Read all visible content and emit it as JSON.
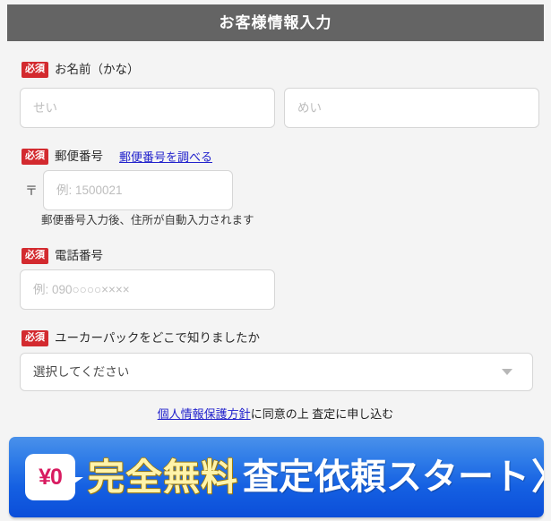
{
  "header": {
    "title": "お客様情報入力",
    "bg_color": "#646464",
    "text_color": "#ffffff"
  },
  "required_badge_label": "必須",
  "colors": {
    "required_badge": "#d32a2f",
    "link": "#2222cc",
    "page_bg": "#f4f4f4",
    "input_border": "#d6d6d6",
    "cta_blue_top": "#4a91ea",
    "cta_blue_bottom": "#0b4ed9",
    "cta_free_text": "#fff3aa",
    "yen_badge_text": "#d81b60"
  },
  "fields": {
    "name": {
      "label": "お名前（かな）",
      "required": "必須",
      "last_name_placeholder": "せい",
      "last_name_value": "",
      "first_name_placeholder": "めい",
      "first_name_value": ""
    },
    "postal": {
      "label": "郵便番号",
      "required": "必須",
      "lookup_link": "郵便番号を調べる",
      "prefix_symbol": "〒",
      "placeholder": "例: 1500021",
      "value": "",
      "helper": "郵便番号入力後、住所が自動入力されます"
    },
    "tel": {
      "label": "電話番号",
      "required": "必須",
      "placeholder": "例: 090○○○○××××",
      "value": ""
    },
    "source": {
      "label": "ユーカーパックをどこで知りましたか",
      "required": "必須",
      "selected": "選択してください",
      "caret": "▼"
    }
  },
  "agreement": {
    "link_text": "個人情報保護方針",
    "rest_text": "に同意の上 査定に申し込む"
  },
  "cta": {
    "badge": "¥0",
    "free_text": "完全無料",
    "main_text": "査定依頼スタート",
    "chevron": "〉"
  }
}
